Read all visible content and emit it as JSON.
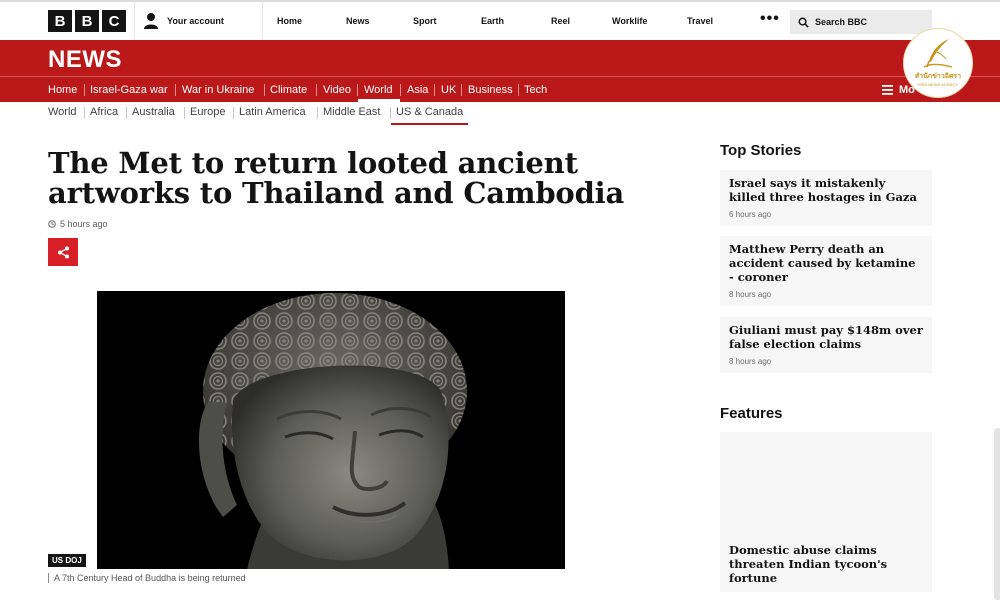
{
  "topbar": {
    "logo_letters": [
      "B",
      "B",
      "C"
    ],
    "account_label": "Your account",
    "nav": [
      "Home",
      "News",
      "Sport",
      "Earth",
      "Reel",
      "Worklife",
      "Travel"
    ],
    "more_label": "•••",
    "search_label": "Search BBC"
  },
  "news": {
    "brand": "NEWS",
    "nav": [
      "Home",
      "Israel-Gaza war",
      "War in Ukraine",
      "Climate",
      "Video",
      "World",
      "Asia",
      "UK",
      "Business",
      "Tech"
    ],
    "active_item": "World",
    "more_label": "Mo"
  },
  "watermark": {
    "thai_text": "สำนักข่าวอิศรา",
    "english_text": "ISRA NEWS AGENCY"
  },
  "subnav": {
    "items": [
      "World",
      "Africa",
      "Australia",
      "Europe",
      "Latin America",
      "Middle East",
      "US & Canada"
    ],
    "active_item": "US & Canada"
  },
  "article": {
    "headline": "The Met to return looted ancient artworks to Thailand and Cambodia",
    "timestamp": "5 hours ago",
    "image_credit": "US DOJ",
    "caption": "A 7th Century Head of Buddha is being returned"
  },
  "top_stories": {
    "heading": "Top Stories",
    "items": [
      {
        "title": "Israel says it mistakenly killed three hostages in Gaza",
        "time": "6 hours ago"
      },
      {
        "title": "Matthew Perry death an accident caused by ketamine - coroner",
        "time": "8 hours ago"
      },
      {
        "title": "Giuliani must pay $148m over false election claims",
        "time": "8 hours ago"
      }
    ]
  },
  "features": {
    "heading": "Features",
    "items": [
      {
        "title": "Domestic abuse claims threaten Indian tycoon's fortune"
      }
    ]
  },
  "colors": {
    "bbc_red": "#bb1919",
    "share_red": "#d61f26",
    "card_background": "#f6f6f6"
  }
}
